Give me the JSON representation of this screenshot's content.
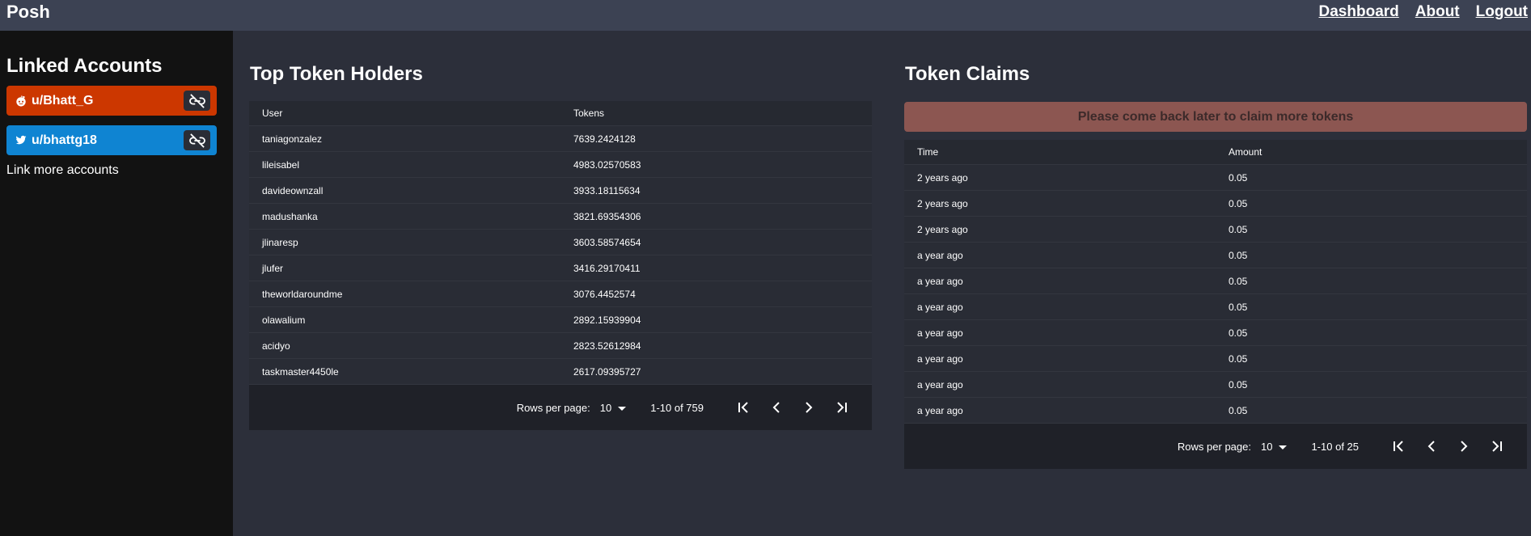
{
  "brand": "Posh",
  "nav": {
    "dashboard": "Dashboard",
    "about": "About",
    "logout": "Logout"
  },
  "sidebar": {
    "title": "Linked Accounts",
    "accounts": [
      {
        "label": "u/Bhatt_G",
        "platform": "reddit",
        "color": "#cc3700"
      },
      {
        "label": "u/bhattg18",
        "platform": "twitter",
        "color": "#0f84d2"
      }
    ],
    "link_more": "Link more accounts"
  },
  "holders": {
    "title": "Top Token Holders",
    "columns": [
      "User",
      "Tokens"
    ],
    "rows": [
      [
        "taniagonzalez",
        "7639.2424128"
      ],
      [
        "lileisabel",
        "4983.02570583"
      ],
      [
        "davideownzall",
        "3933.18115634"
      ],
      [
        "madushanka",
        "3821.69354306"
      ],
      [
        "jlinaresp",
        "3603.58574654"
      ],
      [
        "jlufer",
        "3416.29170411"
      ],
      [
        "theworldaroundme",
        "3076.4452574"
      ],
      [
        "olawalium",
        "2892.15939904"
      ],
      [
        "acidyo",
        "2823.52612984"
      ],
      [
        "taskmaster4450le",
        "2617.09395727"
      ]
    ],
    "footer": {
      "rows_per_page_label": "Rows per page:",
      "rows_per_page": "10",
      "range": "1-10 of 759"
    }
  },
  "claims": {
    "title": "Token Claims",
    "button": "Please come back later to claim more tokens",
    "columns": [
      "Time",
      "Amount"
    ],
    "rows": [
      [
        "2 years ago",
        "0.05"
      ],
      [
        "2 years ago",
        "0.05"
      ],
      [
        "2 years ago",
        "0.05"
      ],
      [
        "a year ago",
        "0.05"
      ],
      [
        "a year ago",
        "0.05"
      ],
      [
        "a year ago",
        "0.05"
      ],
      [
        "a year ago",
        "0.05"
      ],
      [
        "a year ago",
        "0.05"
      ],
      [
        "a year ago",
        "0.05"
      ],
      [
        "a year ago",
        "0.05"
      ]
    ],
    "footer": {
      "rows_per_page_label": "Rows per page:",
      "rows_per_page": "10",
      "range": "1-10 of 25"
    }
  },
  "icons": {
    "reddit": "reddit-icon",
    "twitter": "twitter-icon",
    "unlink": "unlink-icon",
    "caret": "caret-down-icon",
    "first": "first-page-icon",
    "prev": "prev-page-icon",
    "next": "next-page-icon",
    "last": "last-page-icon"
  }
}
